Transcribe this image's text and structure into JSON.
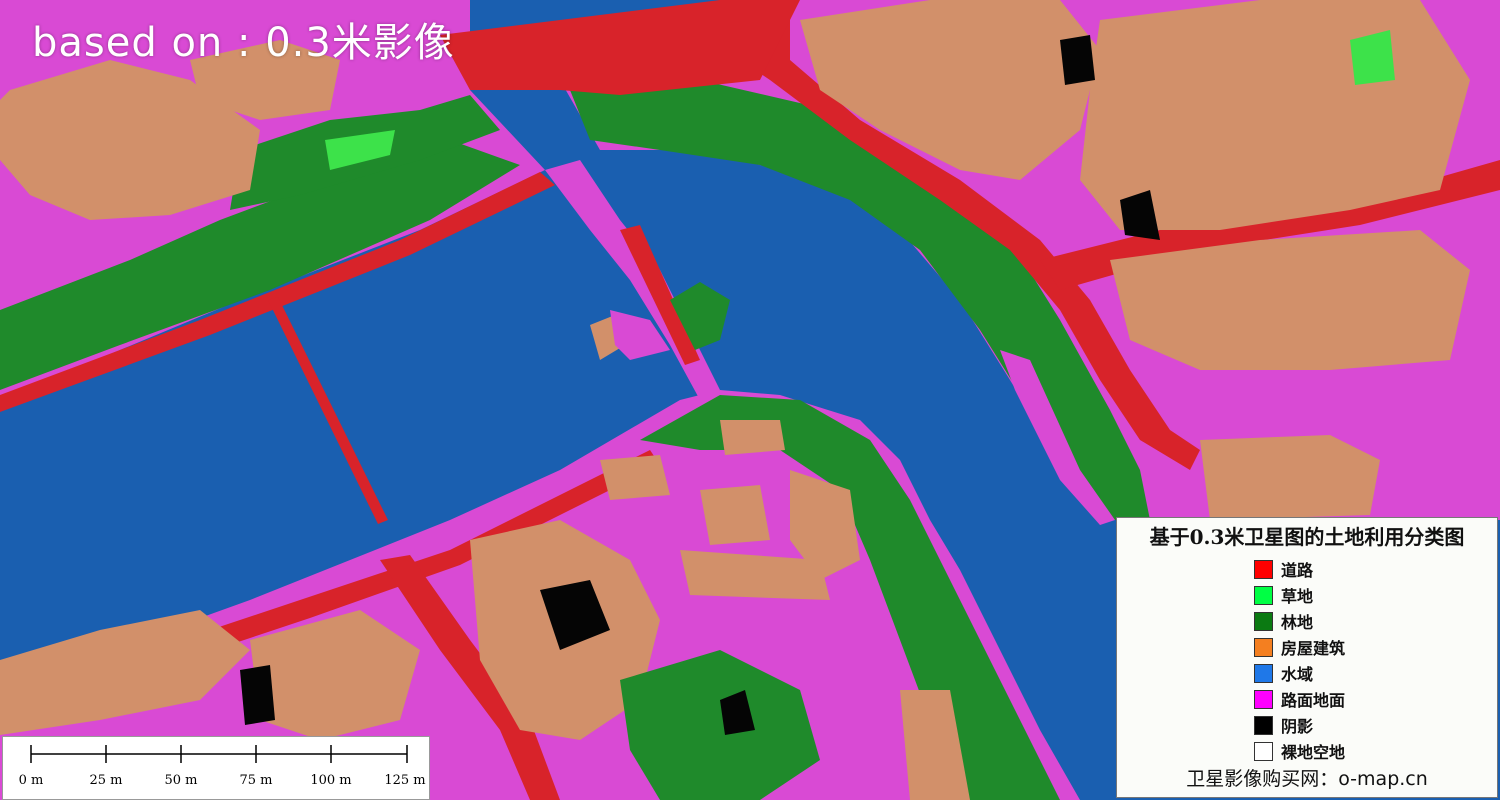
{
  "overlay_title": "based on : 0.3米影像",
  "legend": {
    "title": "基于0.3米卫星图的土地利用分类图",
    "items": [
      {
        "label": "道路",
        "color": "#ff0000"
      },
      {
        "label": "草地",
        "color": "#00ff44"
      },
      {
        "label": "林地",
        "color": "#0b7a12"
      },
      {
        "label": "房屋建筑",
        "color": "#f47f20"
      },
      {
        "label": "水域",
        "color": "#1f78e8"
      },
      {
        "label": "路面地面",
        "color": "#ff00ff"
      },
      {
        "label": "阴影",
        "color": "#000000"
      },
      {
        "label": "裸地空地",
        "color": "#ffffff"
      }
    ],
    "footer": "卫星影像购买网：o-map.cn"
  },
  "scalebar": {
    "ticks": [
      "0 m",
      "25 m",
      "50 m",
      "75 m",
      "100 m",
      "125 m"
    ]
  },
  "colors": {
    "water": "#1a5fb0",
    "road": "#d8232a",
    "forest": "#1f8a2b",
    "grass": "#3de24a",
    "building": "#d2906a",
    "pavement": "#d94ad4",
    "shadow": "#050505"
  }
}
